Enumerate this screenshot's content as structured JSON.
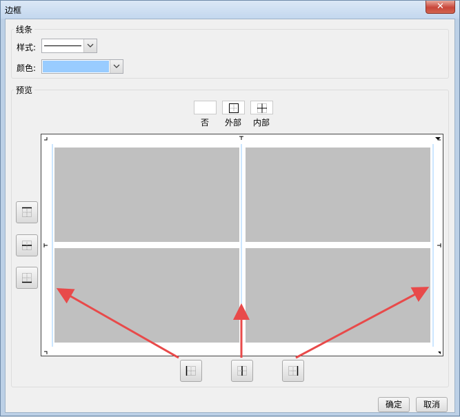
{
  "window": {
    "title": "边框",
    "close_symbol": "✕"
  },
  "line_group": {
    "label": "线条",
    "style_label": "样式:",
    "color_label": "颜色:",
    "style_value": "solid-line",
    "color_value": "#99ccff"
  },
  "preview_group": {
    "label": "预览",
    "presets": [
      {
        "label": "否",
        "icon": "no-border-icon"
      },
      {
        "label": "外部",
        "icon": "outer-border-icon"
      },
      {
        "label": "内部",
        "icon": "inner-border-icon"
      }
    ],
    "cell_color": "#c0c0c0"
  },
  "buttons": {
    "ok": "确定",
    "cancel": "取消"
  },
  "annotation": {
    "arrow_color": "#e84a4a"
  }
}
